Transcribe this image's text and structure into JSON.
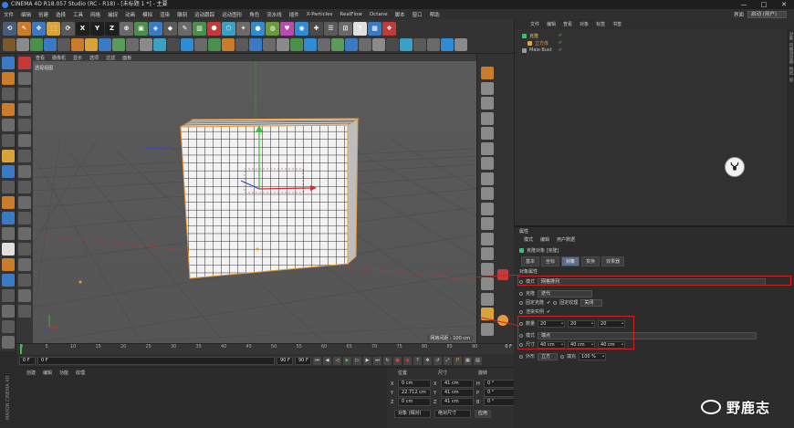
{
  "app": {
    "title": "CINEMA 4D R18.057 Studio (RC - R18) - [未标题 1 *] - 主要",
    "window_buttons": [
      "—",
      "□",
      "✕"
    ]
  },
  "menu": {
    "items": [
      "文件",
      "编辑",
      "创建",
      "选择",
      "工具",
      "网格",
      "捕捉",
      "动画",
      "模拟",
      "渲染",
      "雕刻",
      "运动跟踪",
      "运动图形",
      "角色",
      "流水线",
      "插件",
      "X-Particles",
      "RealFlow",
      "Octane",
      "脚本",
      "窗口",
      "帮助"
    ],
    "layout_label": "界面",
    "layout_value": "启动 (用户)"
  },
  "viewport": {
    "menu": [
      "查看",
      "摄像机",
      "显示",
      "选项",
      "过滤",
      "面板"
    ],
    "camera_label": "透视视图",
    "grid_spacing": "网格间距 : 100 cm"
  },
  "timeline": {
    "ticks": [
      "0",
      "5",
      "10",
      "15",
      "20",
      "25",
      "30",
      "35",
      "40",
      "45",
      "50",
      "55",
      "60",
      "65",
      "70",
      "75",
      "80",
      "85",
      "90"
    ],
    "end_label": "0 F",
    "start_field": "0 F",
    "current_field": "0 F",
    "end_field": "90 F",
    "end_field2": "90 F"
  },
  "materials": {
    "menu": [
      "创建",
      "编辑",
      "功能",
      "纹理"
    ]
  },
  "coordinates": {
    "headers": [
      "位置",
      "尺寸",
      "旋转"
    ],
    "rows": [
      {
        "axis": "X",
        "pos": "0 cm",
        "size": "41 cm",
        "rot_axis": "H",
        "rot": "0 °"
      },
      {
        "axis": "Y",
        "pos": "22.712 cm",
        "size": "41 cm",
        "rot_axis": "P",
        "rot": "0 °"
      },
      {
        "axis": "Z",
        "pos": "0 cm",
        "size": "41 cm",
        "rot_axis": "B",
        "rot": "0 °"
      }
    ],
    "mode": "对象 (相对)",
    "size_mode": "绝对尺寸",
    "apply": "应用"
  },
  "objects": {
    "menu": [
      "文件",
      "编辑",
      "查看",
      "对象",
      "标签",
      "书签"
    ],
    "items": [
      {
        "name": "克隆",
        "color": "#35c46a",
        "indent": 0
      },
      {
        "name": "立方体",
        "color": "#e8a33a",
        "indent": 1
      },
      {
        "name": "Male Bust",
        "color": "#9a9a9a",
        "indent": 0
      }
    ],
    "side_tabs": [
      "对象",
      "内容浏览器",
      "构造",
      "层"
    ]
  },
  "attributes": {
    "title": "属性",
    "menu": [
      "模式",
      "编辑",
      "用户数据"
    ],
    "object_line": "克隆对象 [克隆]",
    "tabs": [
      "基本",
      "坐标",
      "对象",
      "变换",
      "效果器"
    ],
    "active_tab": "对象",
    "section": "对象属性",
    "mode_label": "模式",
    "mode_value": "网格排列",
    "clone_label": "克隆",
    "clone_value": "迭代",
    "fixed_clone_label": "固定克隆",
    "fixed_texture_label": "固定纹理",
    "fixed_texture_value": "关闭",
    "render_instances_label": "渲染实例",
    "count_label": "数量",
    "count": [
      "20",
      "20",
      "20"
    ],
    "mode2_label": "模式",
    "mode2_value": "端点",
    "size_label": "尺寸",
    "size": [
      "40 cm",
      "40 cm",
      "40 cm"
    ],
    "shape_label": "外形",
    "shape_value": "立方",
    "fill_label": "填充",
    "fill_value": "100 %"
  },
  "watermark": {
    "text": "野鹿志"
  }
}
